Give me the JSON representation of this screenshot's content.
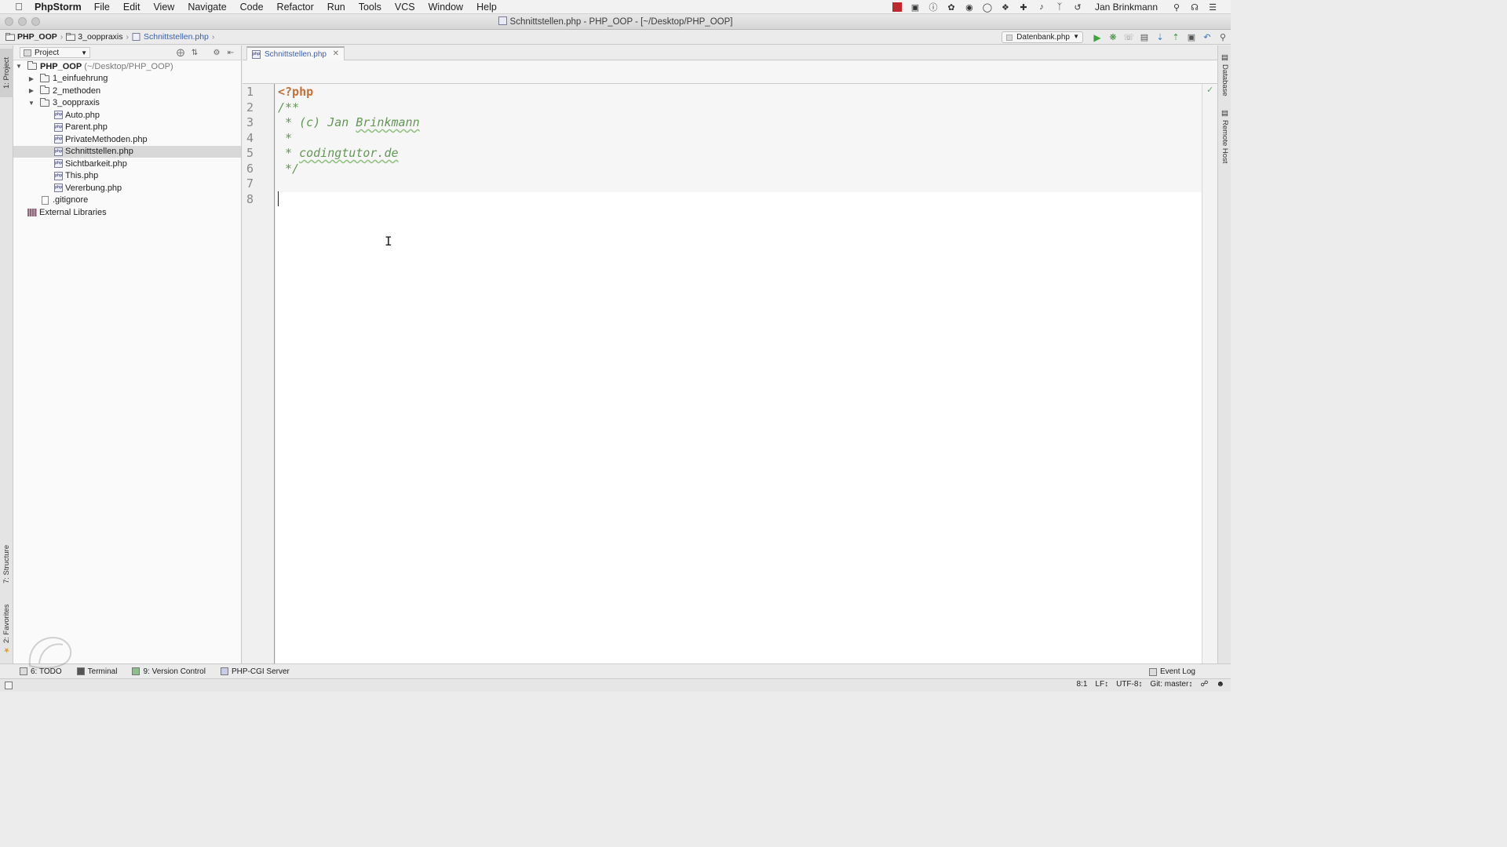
{
  "menubar": {
    "app_name": "PhpStorm",
    "items": [
      "File",
      "Edit",
      "View",
      "Navigate",
      "Code",
      "Refactor",
      "Run",
      "Tools",
      "VCS",
      "Window",
      "Help"
    ],
    "user": "Jan Brinkmann"
  },
  "window": {
    "title": "Schnittstellen.php - PHP_OOP - [~/Desktop/PHP_OOP]"
  },
  "breadcrumb": {
    "items": [
      "PHP_OOP",
      "3_ooppraxis",
      "Schnittstellen.php"
    ]
  },
  "run_config": {
    "label": "Datenbank.php"
  },
  "left_stripe": {
    "project_tab": "1: Project",
    "structure_tab": "7: Structure",
    "favorites_tab": "2: Favorites"
  },
  "project_panel": {
    "view_selector": "Project",
    "tree": {
      "root_name": "PHP_OOP",
      "root_path": "(~/Desktop/PHP_OOP)",
      "folders": [
        "1_einfuehrung",
        "2_methoden",
        "3_ooppraxis"
      ],
      "files": [
        "Auto.php",
        "Parent.php",
        "PrivateMethoden.php",
        "Schnittstellen.php",
        "Sichtbarkeit.php",
        "This.php",
        "Vererbung.php"
      ],
      "gitignore": ".gitignore",
      "external": "External Libraries"
    }
  },
  "editor": {
    "tab_label": "Schnittstellen.php",
    "line_numbers": [
      "1",
      "2",
      "3",
      "4",
      "5",
      "6",
      "7",
      "8"
    ],
    "lines": {
      "l1": "<?php",
      "l2": "/**",
      "l3_prefix": " * (c) Jan ",
      "l3_word": "Brinkmann",
      "l4": " *",
      "l5_prefix": " * ",
      "l5_word": "codingtutor.de",
      "l6": " */"
    }
  },
  "right_stripe": {
    "database_tab": "Database",
    "remote_host_tab": "Remote Host"
  },
  "bottom_tools": {
    "todo": "6: TODO",
    "terminal": "Terminal",
    "version_control": "9: Version Control",
    "php_cgi": "PHP-CGI Server",
    "event_log": "Event Log"
  },
  "status": {
    "position": "8:1",
    "line_sep": "LF↕",
    "encoding": "UTF-8↕",
    "git": "Git: master↕"
  },
  "colors": {
    "keyword": "#c2703a",
    "comment": "#629755",
    "link_blue": "#3b5fa8"
  }
}
